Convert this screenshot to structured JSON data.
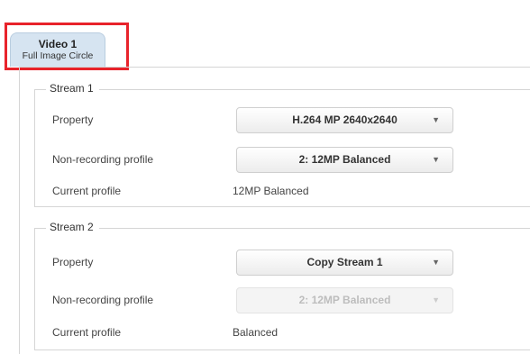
{
  "tab": {
    "title": "Video 1",
    "subtitle": "Full Image Circle"
  },
  "streams": [
    {
      "legend": "Stream 1",
      "property_label": "Property",
      "property_value": "H.264 MP 2640x2640",
      "nonrec_label": "Non-recording profile",
      "nonrec_value": "2: 12MP Balanced",
      "current_label": "Current profile",
      "current_value": "12MP Balanced"
    },
    {
      "legend": "Stream 2",
      "property_label": "Property",
      "property_value": "Copy Stream 1",
      "nonrec_label": "Non-recording profile",
      "nonrec_value": "2: 12MP Balanced",
      "current_label": "Current profile",
      "current_value": "Balanced"
    }
  ],
  "icons": {
    "dropdown": "triangle-down-icon"
  },
  "colors": {
    "tab_bg": "#d6e4f1",
    "highlight": "#e8232b",
    "border": "#d5d5d5"
  }
}
